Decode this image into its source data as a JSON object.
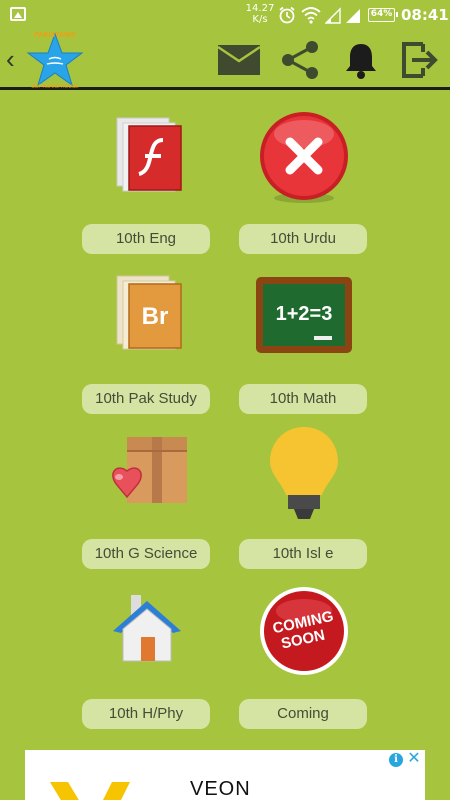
{
  "status_bar": {
    "net_speed_value": "14.27",
    "net_speed_unit": "K/s",
    "battery": "64%",
    "time": "08:41"
  },
  "app_bar": {
    "logo_brand": "PAKISTANIS",
    "logo_sub": "SOFTWARE HOUSE"
  },
  "tiles": [
    {
      "label": "10th Eng",
      "icon": "flash-file-icon"
    },
    {
      "label": "10th Urdu",
      "icon": "red-x-icon"
    },
    {
      "label": "10th Pak Study",
      "icon": "bridge-file-icon"
    },
    {
      "label": "10th Math",
      "icon": "chalkboard-icon"
    },
    {
      "label": "10th G Science",
      "icon": "box-heart-icon"
    },
    {
      "label": "10th Isl e",
      "icon": "lightbulb-icon"
    },
    {
      "label": "10th H/Phy",
      "icon": "house-icon"
    },
    {
      "label": "Coming",
      "icon": "coming-soon-icon"
    }
  ],
  "coming_soon_badge": {
    "line1": "COMING",
    "line2": "SOON"
  },
  "math_board_text": "1+2=3",
  "ad": {
    "text": "VEON",
    "info_label": "i",
    "close_label": "✕"
  },
  "colors": {
    "background": "#a7c43e",
    "label_pill": "#d5e4a3",
    "label_text": "#454d37"
  }
}
